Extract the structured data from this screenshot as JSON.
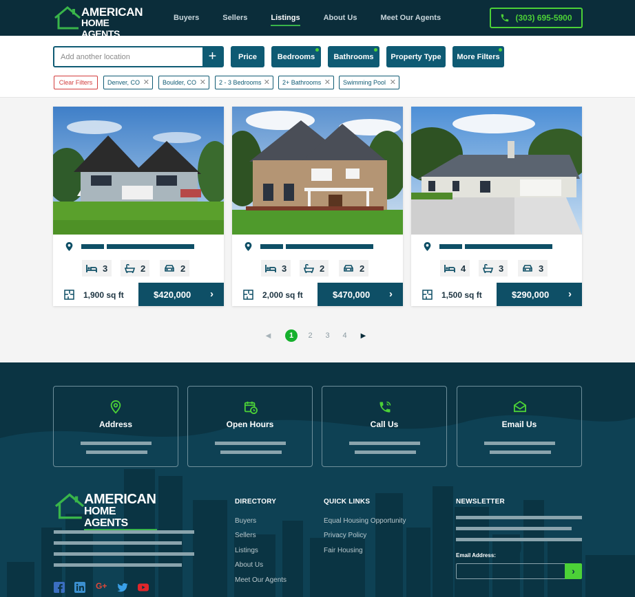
{
  "brand": {
    "line1": "AMERICAN",
    "line2": "HOME AGENTS",
    "accent": "#39b54a"
  },
  "nav": {
    "items": [
      {
        "label": "Buyers",
        "active": false
      },
      {
        "label": "Sellers",
        "active": false
      },
      {
        "label": "Listings",
        "active": true
      },
      {
        "label": "About Us",
        "active": false
      },
      {
        "label": "Meet Our Agents",
        "active": false
      }
    ],
    "phone": "(303) 695-5900"
  },
  "filters": {
    "location_placeholder": "Add another location",
    "buttons": [
      {
        "label": "Price",
        "dot": false
      },
      {
        "label": "Bedrooms",
        "dot": true
      },
      {
        "label": "Bathrooms",
        "dot": true
      },
      {
        "label": "Property Type",
        "dot": false
      },
      {
        "label": "More Filters",
        "dot": true
      }
    ],
    "clear_label": "Clear Filters",
    "chips": [
      "Denver, CO",
      "Boulder, CO",
      "2 - 3 Bedrooms",
      "2+ Bathrooms",
      "Swimming Pool"
    ]
  },
  "listings": [
    {
      "beds": "3",
      "baths": "2",
      "garage": "2",
      "sqft": "1,900 sq ft",
      "price": "$420,000"
    },
    {
      "beds": "3",
      "baths": "2",
      "garage": "2",
      "sqft": "2,000 sq ft",
      "price": "$470,000"
    },
    {
      "beds": "4",
      "baths": "3",
      "garage": "3",
      "sqft": "1,500 sq ft",
      "price": "$290,000"
    }
  ],
  "pagination": {
    "current": "1",
    "pages": [
      "2",
      "3",
      "4"
    ]
  },
  "contact_tiles": [
    {
      "title": "Address",
      "icon": "map-pin-icon"
    },
    {
      "title": "Open Hours",
      "icon": "calendar-clock-icon"
    },
    {
      "title": "Call Us",
      "icon": "phone-call-icon"
    },
    {
      "title": "Email Us",
      "icon": "envelope-open-icon"
    }
  ],
  "footer": {
    "directory": {
      "title": "DIRECTORY",
      "links": [
        "Buyers",
        "Sellers",
        "Listings",
        "About Us",
        "Meet Our Agents"
      ]
    },
    "quick_links": {
      "title": "QUICK LINKS",
      "links": [
        "Equal Housing Opportunity",
        "Privacy Policy",
        "Fair Housing"
      ]
    },
    "newsletter": {
      "title": "NEWSLETTER",
      "email_label": "Email Address:"
    },
    "social": [
      "facebook-icon",
      "linkedin-icon",
      "google-plus-icon",
      "twitter-icon",
      "youtube-icon"
    ]
  }
}
